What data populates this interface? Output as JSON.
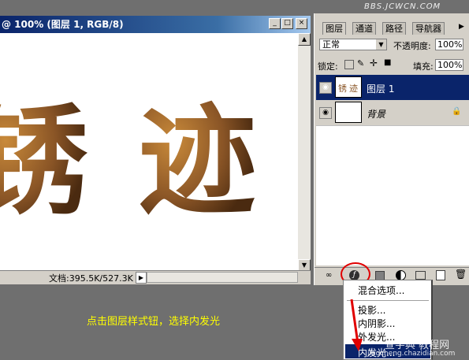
{
  "document": {
    "title": "@ 100% (图层 1, RGB/8)",
    "title_buttons": [
      "_",
      "□",
      "×"
    ],
    "doc_size": "文档:395.5K/527.3K",
    "nav_arrow": "▶"
  },
  "artwork": {
    "glyph1": "锈",
    "glyph2": "迹",
    "ink_color": "#7a4a22",
    "highlight_color": "#c98a3a"
  },
  "panel": {
    "tabs": [
      "图层",
      "通道",
      "路径",
      "导航器"
    ],
    "blend_mode": "正常",
    "opacity_label": "不透明度:",
    "opacity_value": "100%",
    "lock_label": "锁定:",
    "fill_label": "填充:",
    "fill_value": "100%",
    "layers": [
      {
        "name": "图层 1",
        "selected": true
      },
      {
        "name": "背景",
        "locked": true
      }
    ]
  },
  "menu": {
    "items": [
      "混合选项...",
      "投影...",
      "内阴影...",
      "外发光...",
      "内发光..."
    ],
    "highlighted_index": 4
  },
  "caption": "点击图层样式钮，选择内发光",
  "watermark_top": "BBS.JCWCN.COM",
  "watermark_bottom": "查字典 教程网",
  "watermark_bottom_url": "jiaocheng.chazidian.com",
  "colors": {
    "selection_blue": "#0a246a",
    "caption_yellow": "#ffff00",
    "highlight_circle": "#e00000",
    "arrow": "#e00000"
  }
}
